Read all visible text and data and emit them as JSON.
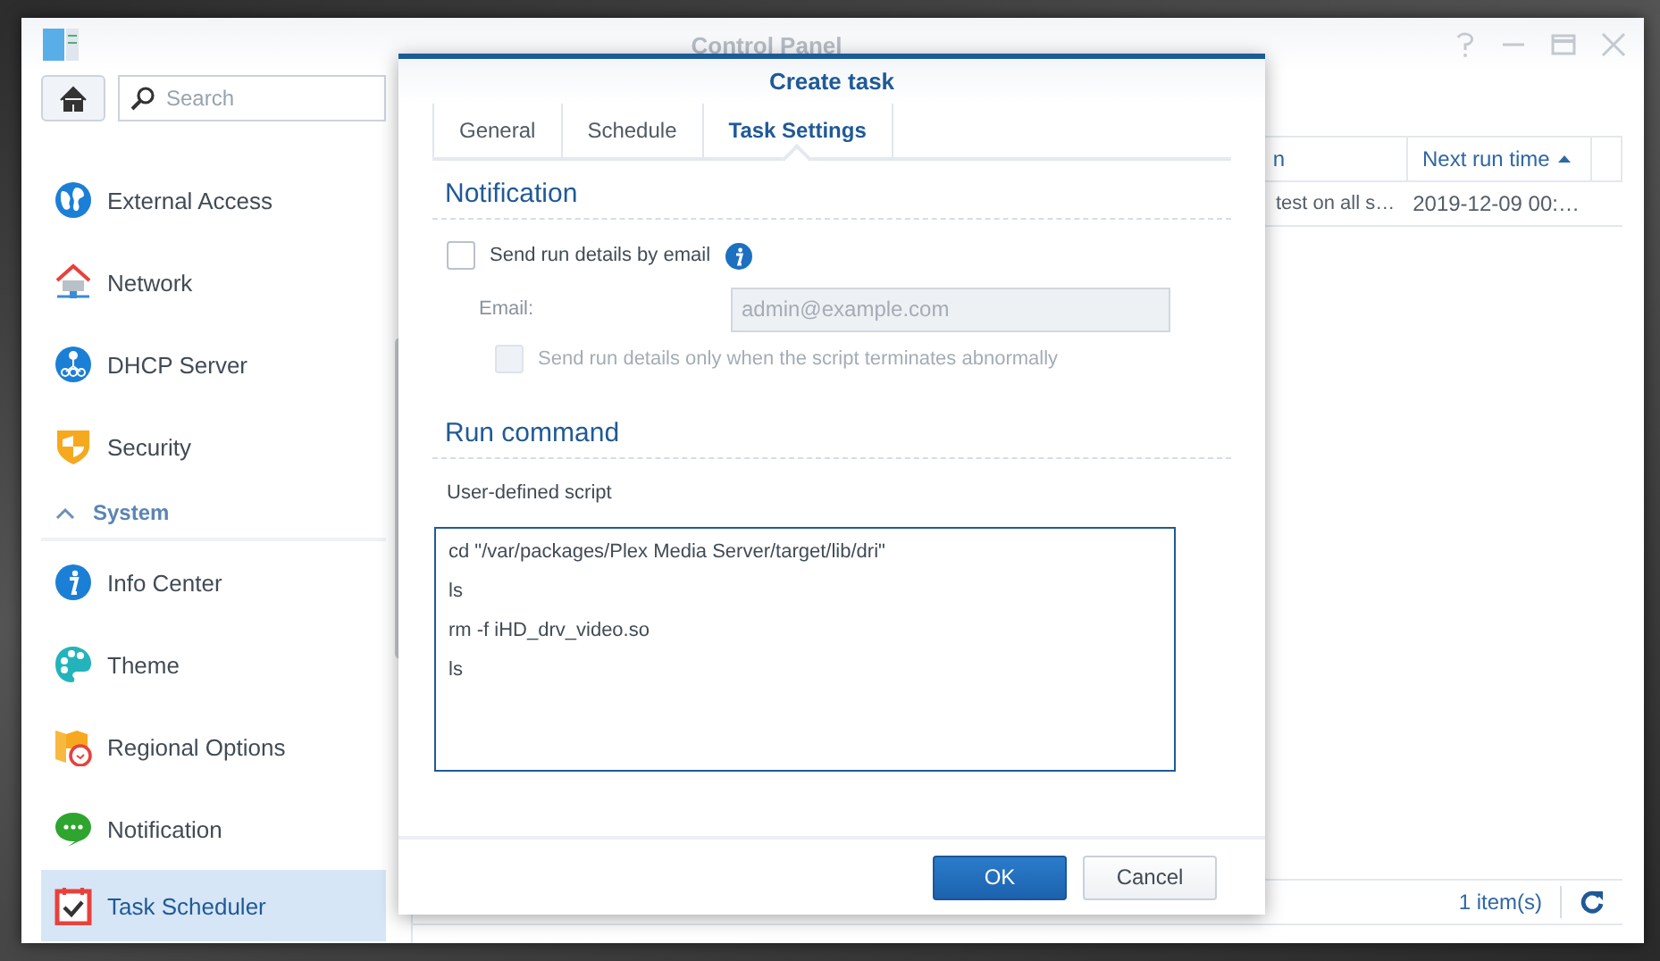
{
  "window": {
    "title": "Control Panel"
  },
  "sidebar": {
    "search": {
      "placeholder": "Search"
    },
    "items": [
      {
        "kind": "item",
        "label": "External Access",
        "selected": false
      },
      {
        "kind": "item",
        "label": "Network",
        "selected": false
      },
      {
        "kind": "item",
        "label": "DHCP Server",
        "selected": false
      },
      {
        "kind": "item",
        "label": "Security",
        "selected": false
      },
      {
        "kind": "section",
        "label": "System",
        "expanded": true
      },
      {
        "kind": "item",
        "label": "Info Center",
        "selected": false
      },
      {
        "kind": "item",
        "label": "Theme",
        "selected": false
      },
      {
        "kind": "item",
        "label": "Regional Options",
        "selected": false
      },
      {
        "kind": "item",
        "label": "Notification",
        "selected": false
      },
      {
        "kind": "item",
        "label": "Task Scheduler",
        "selected": true
      }
    ]
  },
  "table": {
    "columns": [
      {
        "label": "n"
      },
      {
        "label": "Next run time",
        "sorted": true
      }
    ],
    "rows": [
      [
        "test on all s…",
        "2019-12-09 00:…"
      ]
    ],
    "footer": "1 item(s)"
  },
  "dialog": {
    "title": "Create task",
    "tabs": [
      {
        "label": "General",
        "selected": false
      },
      {
        "label": "Schedule",
        "selected": false
      },
      {
        "label": "Task Settings",
        "selected": true
      }
    ],
    "notification": {
      "heading": "Notification",
      "send_email": {
        "label": "Send run details by email",
        "checked": false
      },
      "email": {
        "label": "Email:",
        "placeholder": "admin@example.com",
        "disabled": true
      },
      "abnormal_only": {
        "label": "Send run details only when the script terminates abnormally",
        "checked": false,
        "disabled": true
      }
    },
    "run_command": {
      "heading": "Run command",
      "label": "User-defined script",
      "script": "cd \"/var/packages/Plex Media Server/target/lib/dri\"\nls\nrm -f iHD_drv_video.so\nls\n"
    },
    "buttons": [
      {
        "kind": "primary",
        "label": "OK"
      },
      {
        "kind": "secondary",
        "label": "Cancel"
      }
    ]
  }
}
